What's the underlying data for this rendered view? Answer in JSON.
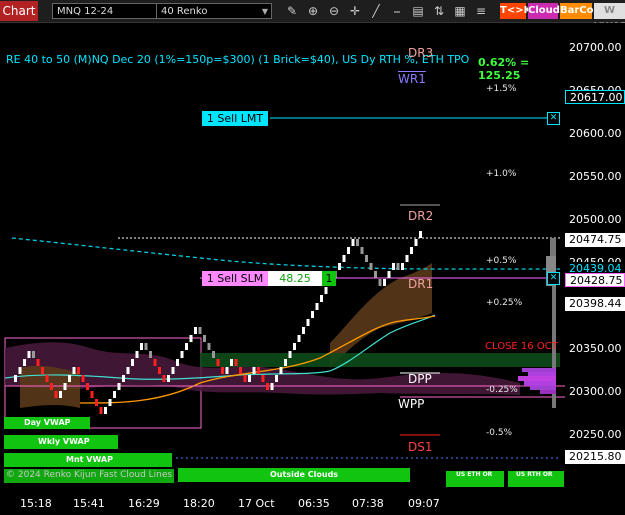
{
  "toolbar": {
    "chart_tab": "Chart",
    "instrument": "MNQ 12-24",
    "bar_type": "40 Renko",
    "btn_tk": "T<>K",
    "btn_cloud": "Cloud",
    "btn_barcol": "BarCol",
    "btn_vwap": "W VWAP"
  },
  "chart": {
    "title": "RE 40 to 50 (M)NQ Dec 20 (1%=150p=$300) (1 Brick=$40), US Dy RTH %, ETH TPO",
    "change": "0.62% = 125.25",
    "watermark": "© 2024 Renko Kijun Fast Cloud Lines"
  },
  "levels": {
    "dr3": "DR3",
    "wr1": "WR1",
    "dr2": "DR2",
    "dr1": "DR1",
    "dpp": "DPP",
    "wpp": "WPP",
    "ds1": "DS1",
    "close": "CLOSE 16 OCT"
  },
  "pcts": {
    "p15": "+1.5%",
    "p10": "+1.0%",
    "p05": "+0.5%",
    "p025": "+0.25%",
    "m025": "-0.25%",
    "m05": "-0.5%"
  },
  "orders": {
    "sell_lmt": "1 Sell LMT",
    "sell_slm": "1 Sell SLM",
    "slm_value": "48.25",
    "slm_qty": "1"
  },
  "vwap": {
    "day": "Day VWAP",
    "wkly": "Wkly VWAP",
    "mnt": "Mnt VWAP",
    "outside": "Outside Clouds",
    "us_eth": "US ETH OR",
    "us_rth": "US RTH OR"
  },
  "price_axis": {
    "ticks": [
      "20700.00",
      "20650.00",
      "20600.00",
      "20550.00",
      "20500.00",
      "20450.00",
      "20400.00",
      "20350.00",
      "20300.00",
      "20250.00"
    ],
    "lmt_price": "20617.00",
    "last_price": "20474.75",
    "p1": "20439.04",
    "slm_price": "20428.75",
    "p2": "20398.44",
    "bottom_price": "20215.80"
  },
  "time_axis": [
    "15:18",
    "15:41",
    "16:29",
    "18:20",
    "17 Oct",
    "06:35",
    "07:38",
    "09:07"
  ],
  "colors": {
    "up": "#ffffff",
    "down": "#ff2020",
    "cyan": "#00e5ff",
    "green": "#10c410",
    "magenta": "#cc66cc",
    "orange": "#ff9900"
  }
}
